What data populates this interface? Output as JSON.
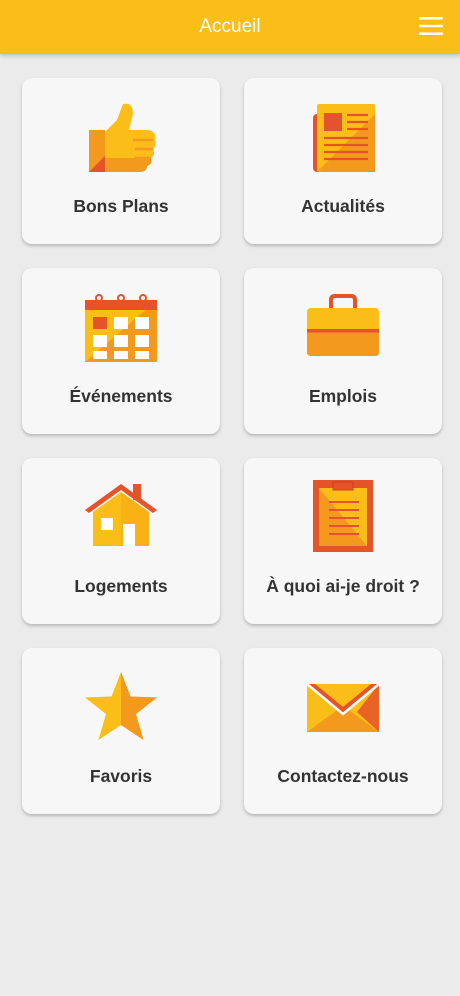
{
  "header": {
    "title": "Accueil",
    "menu_icon": "hamburger-menu-icon",
    "background_color": "#fbbd18",
    "title_color": "#ffffff"
  },
  "colors": {
    "page_background": "#ebebeb",
    "tile_background": "#f7f7f7",
    "icon_yellow": "#fbbd18",
    "icon_orange": "#f39a1e",
    "icon_red": "#e5532a",
    "label_color": "#333333"
  },
  "tiles": [
    {
      "label": "Bons Plans",
      "icon": "thumbs-up-icon"
    },
    {
      "label": "Actualités",
      "icon": "newspaper-icon"
    },
    {
      "label": "Événements",
      "icon": "calendar-icon"
    },
    {
      "label": "Emplois",
      "icon": "briefcase-icon"
    },
    {
      "label": "Logements",
      "icon": "house-icon"
    },
    {
      "label": "À quoi ai-je droit ?",
      "icon": "clipboard-icon"
    },
    {
      "label": "Favoris",
      "icon": "star-icon"
    },
    {
      "label": "Contactez-nous",
      "icon": "envelope-icon"
    }
  ]
}
